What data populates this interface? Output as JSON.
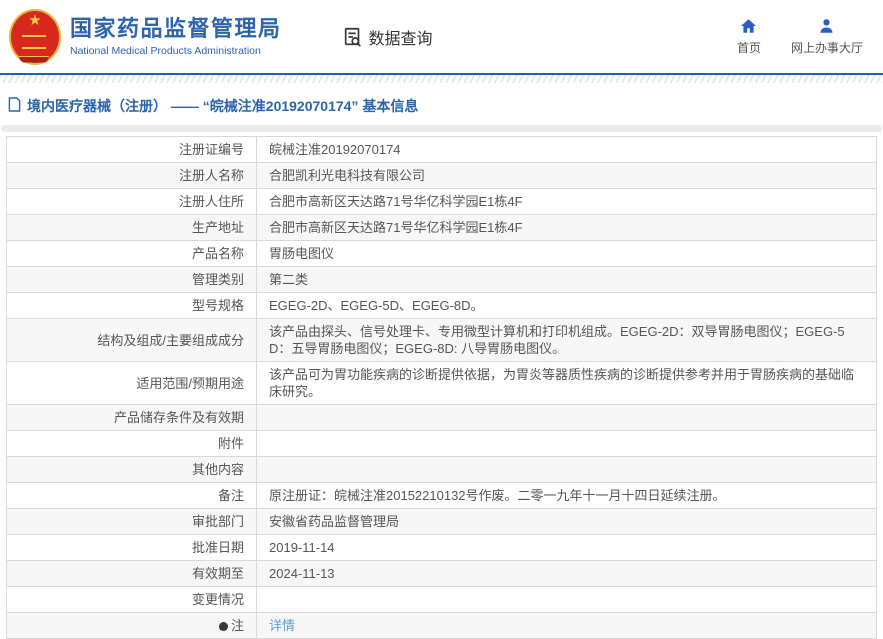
{
  "header": {
    "org_name_zh": "国家药品监督管理局",
    "org_name_en": "National Medical Products Administration",
    "nav_query": "数据查询",
    "link_home": "首页",
    "link_hall": "网上办事大厅"
  },
  "page_title": "境内医疗器械（注册） —— “皖械注准20192070174” 基本信息",
  "table": {
    "rows": [
      {
        "label": "注册证编号",
        "value": "皖械注准20192070174"
      },
      {
        "label": "注册人名称",
        "value": "合肥凯利光电科技有限公司"
      },
      {
        "label": "注册人住所",
        "value": "合肥市高新区天达路71号华亿科学园E1栋4F"
      },
      {
        "label": "生产地址",
        "value": "合肥市高新区天达路71号华亿科学园E1栋4F"
      },
      {
        "label": "产品名称",
        "value": "胃肠电图仪"
      },
      {
        "label": "管理类别",
        "value": "第二类"
      },
      {
        "label": "型号规格",
        "value": "EGEG-2D、EGEG-5D、EGEG-8D。"
      },
      {
        "label": "结构及组成/主要组成成分",
        "value": "该产品由探头、信号处理卡、专用微型计算机和打印机组成。EGEG-2D：双导胃肠电图仪；EGEG-5D：五导胃肠电图仪；EGEG-8D: 八导胃肠电图仪。"
      },
      {
        "label": "适用范围/预期用途",
        "value": "该产品可为胃功能疾病的诊断提供依据，为胃炎等器质性疾病的诊断提供参考并用于胃肠疾病的基础临床研究。"
      },
      {
        "label": "产品储存条件及有效期",
        "value": ""
      },
      {
        "label": "附件",
        "value": ""
      },
      {
        "label": "其他内容",
        "value": ""
      },
      {
        "label": "备注",
        "value": "原注册证：皖械注准20152210132号作废。二零一九年十一月十四日延续注册。"
      },
      {
        "label": "审批部门",
        "value": "安徽省药品监督管理局"
      },
      {
        "label": "批准日期",
        "value": "2019-11-14"
      },
      {
        "label": "有效期至",
        "value": "2024-11-13"
      },
      {
        "label": "变更情况",
        "value": ""
      },
      {
        "label": "注",
        "value": "",
        "icon": "pin",
        "link": "详情"
      }
    ]
  },
  "colors": {
    "brand_blue": "#2e63ae",
    "separator_blue": "#1c61b3",
    "title_blue": "#2a64ad",
    "link_blue": "#58a0dc",
    "emblem_red": "#d7281e",
    "emblem_gold": "#f7c948",
    "row_alt_bg": "#f7f7f7",
    "table_border": "#d9d9d9",
    "text_gray": "#555555"
  }
}
